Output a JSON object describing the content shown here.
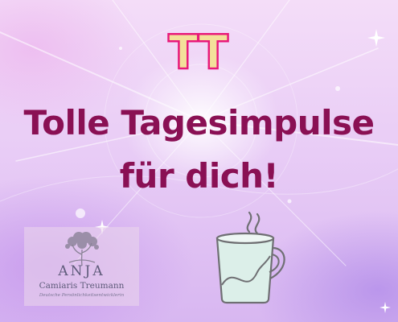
{
  "logo": {
    "text": "TT",
    "fill_color": "#f3e09a",
    "outline_color": "#e8197a"
  },
  "headline": {
    "line1": "Tolle Tagesimpulse",
    "line2": "für dich!",
    "color": "#8a1054"
  },
  "badge": {
    "name": "ANJA",
    "subtitle": "Camiaris Treumann",
    "tagline": "Deutsche Persönlichkeitsentwicklerin",
    "icon": "tree-icon"
  },
  "illustration": {
    "icon": "coffee-cup-icon",
    "color": "#6f6f73",
    "tint": "#dcefe9"
  },
  "decor": {
    "icon": "sparkle-icon"
  }
}
